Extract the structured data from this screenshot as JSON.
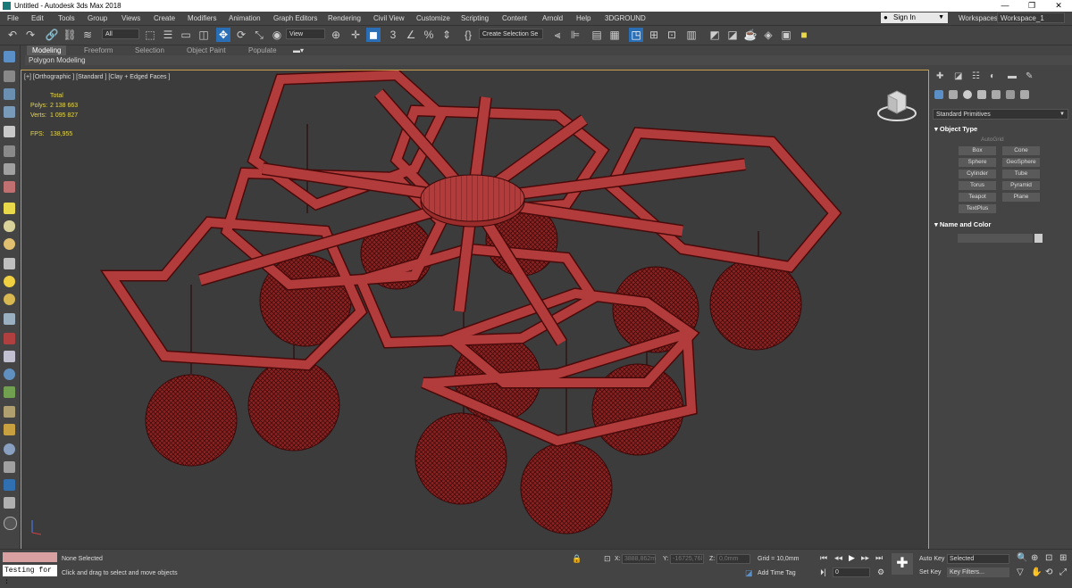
{
  "window": {
    "title": "Untitled - Autodesk 3ds Max 2018",
    "minimize": "—",
    "maximize": "❐",
    "close": "✕"
  },
  "menu": {
    "items": [
      "File",
      "Edit",
      "Tools",
      "Group",
      "Views",
      "Create",
      "Modifiers",
      "Animation",
      "Graph Editors",
      "Rendering",
      "Civil View",
      "Customize",
      "Scripting",
      "Content",
      "Arnold",
      "Help",
      "3DGROUND"
    ],
    "sign_in": "Sign In",
    "workspaces_label": "Workspaces:",
    "workspace_value": "Workspace_1"
  },
  "toolbar": {
    "selection_filter": "All",
    "ref_coord": "View",
    "selection_set": "Create Selection Se",
    "snap_label": "3"
  },
  "ribbon": {
    "tabs": [
      "Modeling",
      "Freeform",
      "Selection",
      "Object Paint",
      "Populate"
    ],
    "active_tab": "Modeling",
    "panel": "Polygon Modeling"
  },
  "viewport": {
    "label": "[+] [Orthographic ] [Standard ] [Clay + Edged Faces ]",
    "stats": {
      "total_label": "Total",
      "polys_label": "Polys:",
      "polys_value": "2 138 663",
      "verts_label": "Verts:",
      "verts_value": "1 095 827",
      "fps_label": "FPS:",
      "fps_value": "138,955"
    },
    "colors": {
      "model": "#b23b3b",
      "model_edge": "#4a0a0a",
      "background": "#3c3c3c",
      "frame": "#c9a14a"
    }
  },
  "command_panel": {
    "dropdown": "Standard Primitives",
    "object_type": {
      "title": "Object Type",
      "autogrid": "AutoGrid",
      "buttons": [
        "Box",
        "Cone",
        "Sphere",
        "GeoSphere",
        "Cylinder",
        "Tube",
        "Torus",
        "Pyramid",
        "Teapot",
        "Plane",
        "TextPlus"
      ]
    },
    "name_color": {
      "title": "Name and Color"
    }
  },
  "status": {
    "none_selected": "None Selected",
    "prompt": "Click and drag to select and move objects",
    "maxscript_input": "Testing for :",
    "x_label": "X:",
    "x_value": "3888,862m",
    "y_label": "Y:",
    "y_value": "-16725,76l",
    "z_label": "Z:",
    "z_value": "0,0mm",
    "grid": "Grid = 10,0mm",
    "add_time_tag": "Add Time Tag",
    "frame": "0",
    "auto_key": "Auto Key",
    "set_key": "Set Key",
    "selected": "Selected",
    "key_filters": "Key Filters..."
  }
}
